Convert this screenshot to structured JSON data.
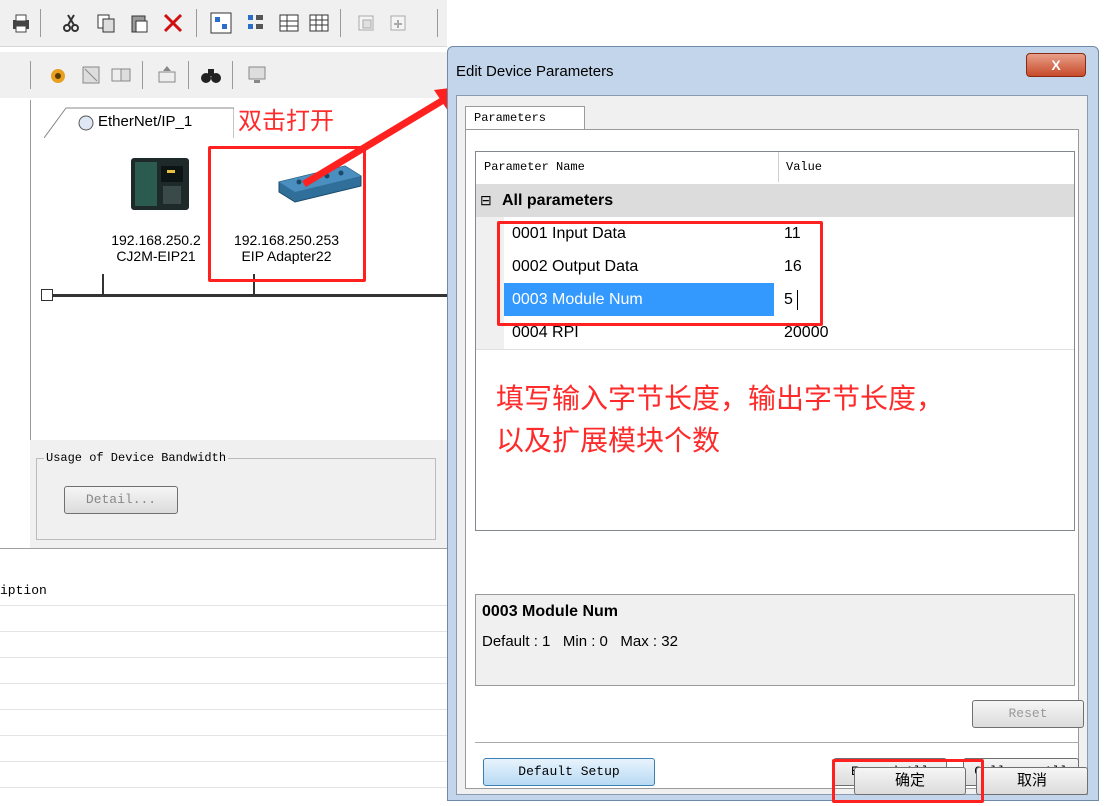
{
  "background_app": {
    "network_tab_label": "EtherNet/IP_1",
    "devices": [
      {
        "ip": "192.168.250.2",
        "name": "CJ2M-EIP21"
      },
      {
        "ip": "192.168.250.253",
        "name": "EIP Adapter22"
      }
    ],
    "bandwidth_group_label": "Usage of Device Bandwidth",
    "detail_button": "Detail...",
    "description_header": "iption"
  },
  "dialog": {
    "title": "Edit Device Parameters",
    "close_glyph": "X",
    "tab_label": "Parameters",
    "columns": {
      "name": "Parameter Name",
      "value": "Value"
    },
    "group_label": "All parameters",
    "group_toggle": "⊟",
    "parameters": [
      {
        "name": "0001 Input Data",
        "value": "11"
      },
      {
        "name": "0002 Output Data",
        "value": "16"
      },
      {
        "name": "0003 Module Num",
        "value": "5"
      },
      {
        "name": "0004 RPI",
        "value": "20000"
      }
    ],
    "selected_parameter": {
      "title": "0003 Module Num",
      "info": "Default : 1   Min : 0   Max : 32"
    },
    "buttons": {
      "reset": "Reset",
      "default_setup": "Default Setup",
      "expand_all": "Expand All",
      "collapse_all": "Collapse All",
      "ok": "确定",
      "cancel": "取消"
    }
  },
  "annotations": {
    "double_click": "双击打开",
    "instruction_line1": "填写输入字节长度，输出字节长度，",
    "instruction_line2": "以及扩展模块个数",
    "color": "#ff2020"
  }
}
